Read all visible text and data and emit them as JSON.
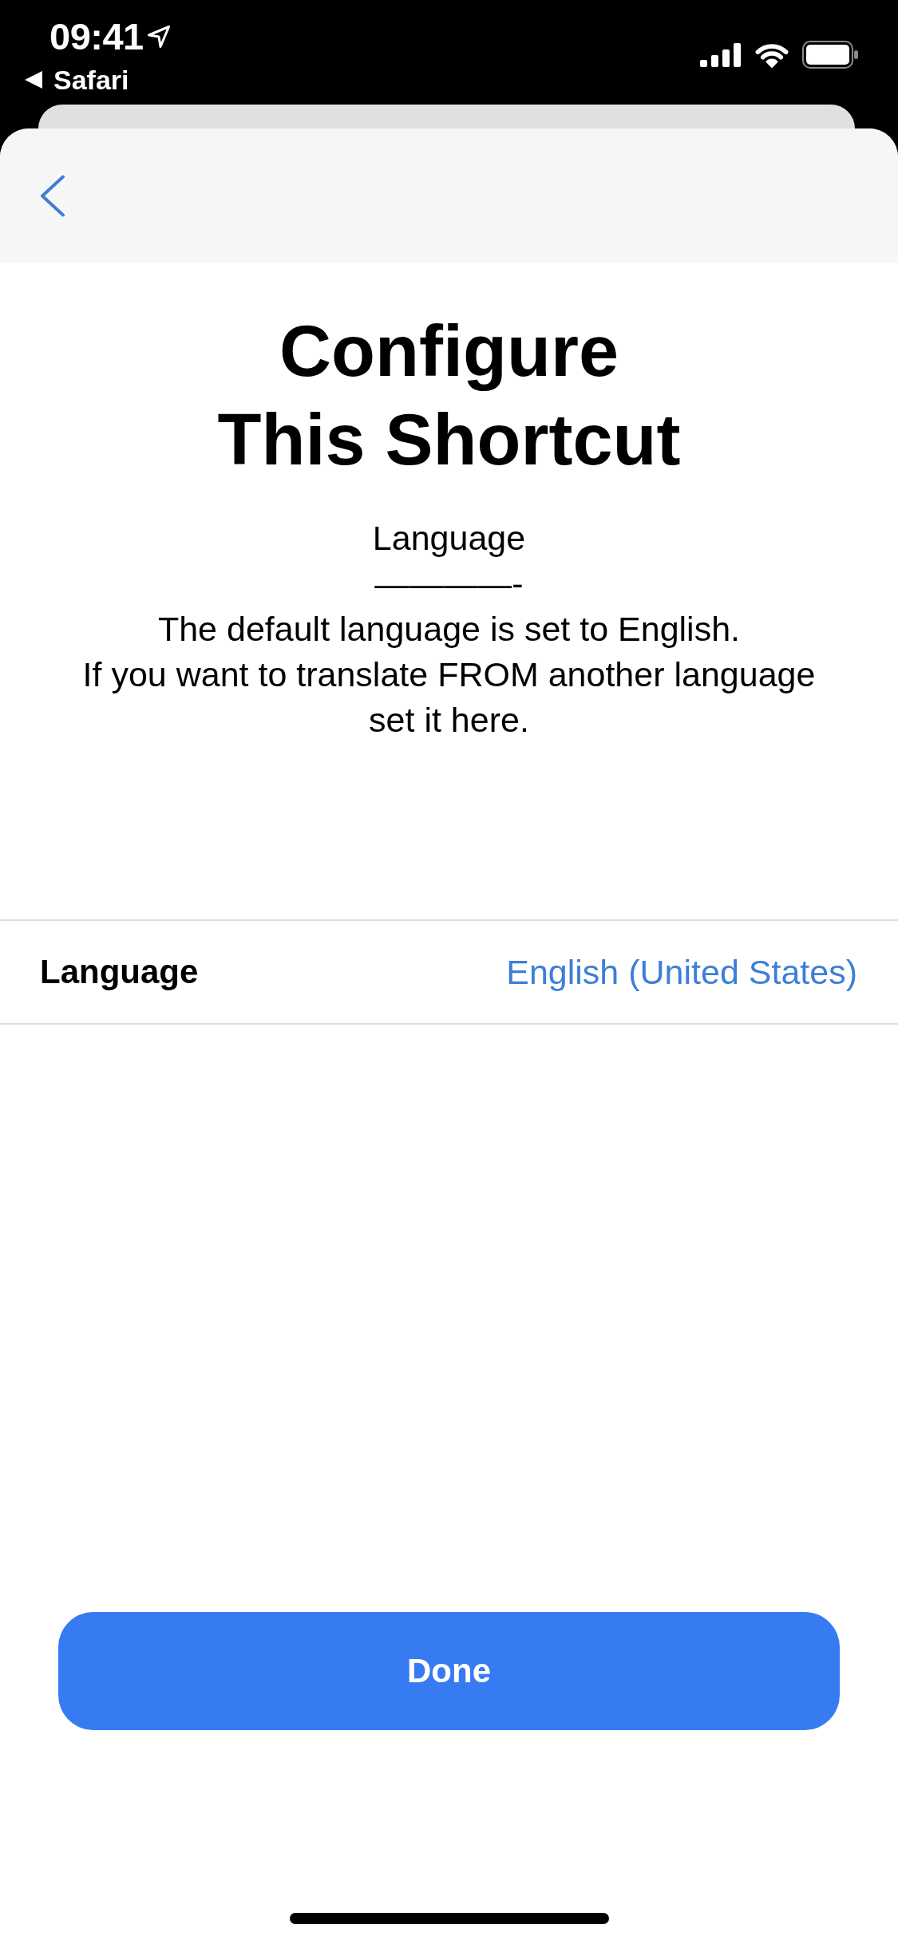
{
  "status_bar": {
    "time": "09:41",
    "back_app": "Safari"
  },
  "title": "Configure This Shortcut",
  "prompt": {
    "heading": "Language",
    "separator": "————-",
    "description": "The default language is set to English.\nIf you want to translate FROM another language\nset it here."
  },
  "row": {
    "label": "Language",
    "value": "English (United States)"
  },
  "done_button": {
    "label": "Done"
  }
}
